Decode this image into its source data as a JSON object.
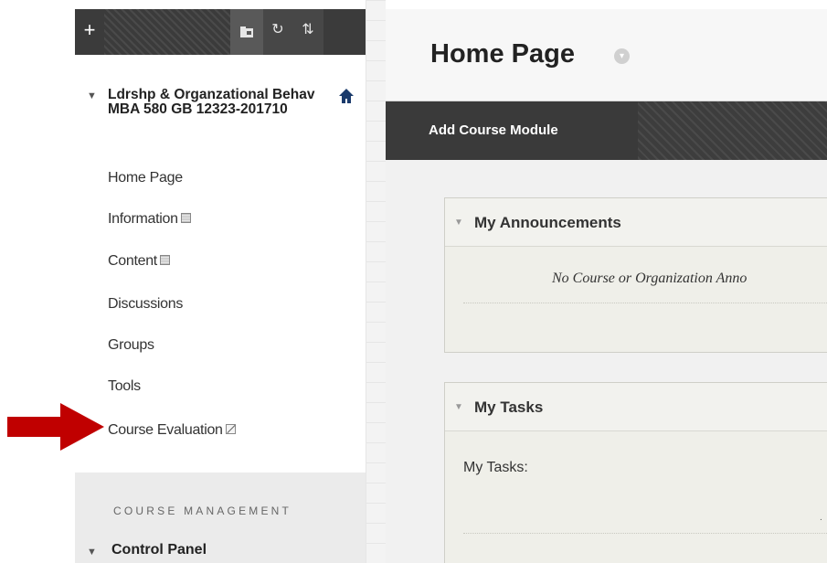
{
  "toolbar": {
    "add_icon": "plus-icon",
    "folder_icon": "folder-icon",
    "refresh_icon": "refresh-icon",
    "sort_icon": "sort-arrows-icon",
    "add_glyph": "+",
    "refresh_glyph": "↻",
    "sort_glyph": "⇅"
  },
  "course": {
    "title": "Ldrshp & Organzational Behav MBA 580 GB 12323-201710",
    "toggle": "▼"
  },
  "nav": {
    "items": [
      {
        "label": "Home Page"
      },
      {
        "label": "Information"
      },
      {
        "label": "Content"
      },
      {
        "label": "Discussions"
      },
      {
        "label": "Groups"
      },
      {
        "label": "Tools"
      },
      {
        "label": "Course Evaluation"
      }
    ]
  },
  "management": {
    "label": "COURSE MANAGEMENT",
    "control_panel": "Control Panel",
    "toggle": "▼"
  },
  "main": {
    "page_title": "Home Page",
    "add_module": "Add Course Module",
    "announcements": {
      "title": "My Announcements",
      "empty_text": "No Course or Organization Anno",
      "toggle": "▼"
    },
    "tasks": {
      "title": "My Tasks",
      "label": "My Tasks:",
      "toggle": "▼",
      "trail": "."
    }
  },
  "colors": {
    "arrow": "#c00000",
    "toolbar": "#3b3b3b",
    "home_icon": "#1a3a6b"
  }
}
